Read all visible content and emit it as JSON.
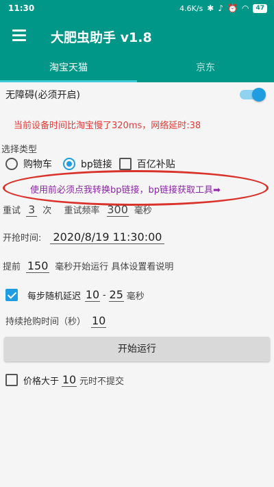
{
  "status_bar": {
    "time": "11:30",
    "network_speed": "4.6K/s",
    "battery": "47",
    "icons": [
      "bluetooth-icon",
      "mute-icon",
      "alarm-icon",
      "wifi-icon",
      "battery-icon"
    ]
  },
  "app": {
    "title": "大肥虫助手 v1.8",
    "accent_color": "#009688"
  },
  "tabs": [
    {
      "label": "淘宝天猫",
      "active": true
    },
    {
      "label": "京东",
      "active": false
    }
  ],
  "accessibility": {
    "label": "无障碍(必须开启)",
    "enabled": true
  },
  "notice": "当前设备时间比淘宝慢了320ms，网络延时:38",
  "select_type": {
    "label": "选择类型",
    "options": [
      {
        "label": "购物车",
        "checked": false
      },
      {
        "label": "bp链接",
        "checked": true
      },
      {
        "label": "百亿补贴",
        "checked": false
      }
    ]
  },
  "bp_link_notice": "使用前必须点我转换bp链接，bp链接获取工具➡",
  "retry": {
    "prefix": "重试",
    "count": "3",
    "count_unit": "次",
    "freq_label": "重试频率",
    "freq_value": "300",
    "freq_unit": "毫秒"
  },
  "start_time": {
    "label": "开抢时间:",
    "value": "2020/8/19 11:30:00"
  },
  "advance": {
    "prefix": "提前",
    "value": "150",
    "suffix": "毫秒开始运行 具体设置看说明"
  },
  "random_delay": {
    "checked": true,
    "label": "每步随机延迟",
    "min": "10",
    "dash": "-",
    "max": "25",
    "unit": "毫秒"
  },
  "duration": {
    "label": "持续抢购时间（秒）",
    "value": "10"
  },
  "start_button": "开始运行",
  "price_limit": {
    "checked": false,
    "prefix": "价格大于",
    "value": "10",
    "suffix": "元时不提交"
  }
}
